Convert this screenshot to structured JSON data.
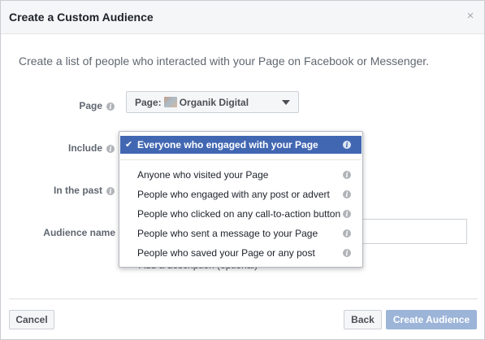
{
  "dialog": {
    "title": "Create a Custom Audience",
    "close_glyph": "×"
  },
  "intro_text": "Create a list of people who interacted with your Page on Facebook or Messenger.",
  "form": {
    "page_label": "Page",
    "page_select_prefix": "Page:",
    "page_select_value": "Organik Digital",
    "include_label": "Include",
    "past_label": "In the past",
    "audience_name_label": "Audience name",
    "description_link": "Add a description (optional)"
  },
  "include_dropdown": {
    "selected": "Everyone who engaged with your Page",
    "options": [
      "Anyone who visited your Page",
      "People who engaged with any post or advert",
      "People who clicked on any call-to-action button",
      "People who sent a message to your Page",
      "People who saved your Page or any post"
    ]
  },
  "footer": {
    "cancel_label": "Cancel",
    "back_label": "Back",
    "create_label": "Create Audience"
  },
  "colors": {
    "primary_blue": "#4267b2",
    "disabled_blue": "#9cb4d8",
    "header_bg": "#f5f6f7"
  },
  "icons": {
    "info": "info-icon",
    "check": "checkmark-icon",
    "close": "close-icon",
    "caret": "caret-down-icon"
  }
}
